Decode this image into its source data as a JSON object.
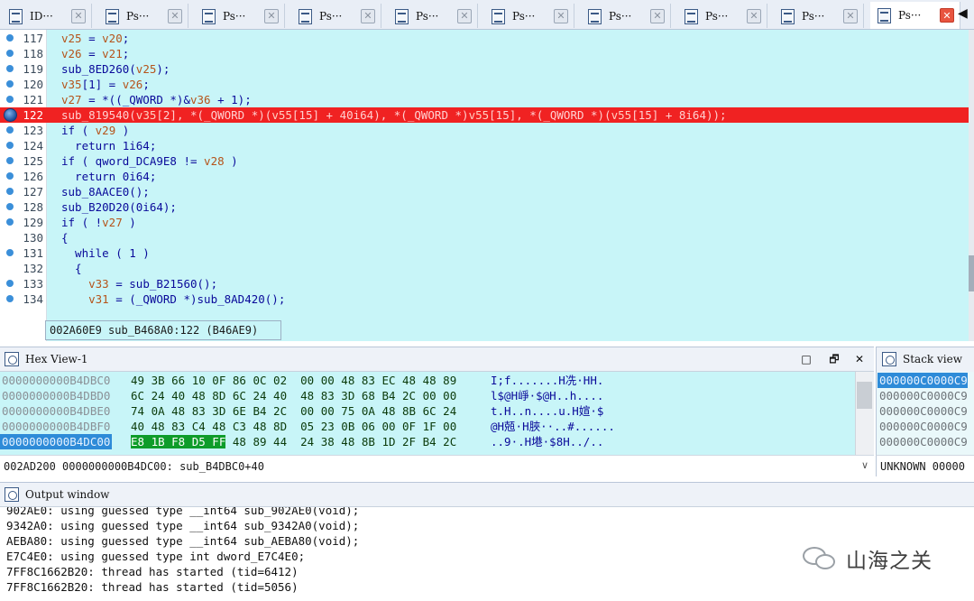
{
  "tabs": [
    {
      "label": "ID···",
      "active": false
    },
    {
      "label": "Ps···",
      "active": false
    },
    {
      "label": "Ps···",
      "active": false
    },
    {
      "label": "Ps···",
      "active": false
    },
    {
      "label": "Ps···",
      "active": false
    },
    {
      "label": "Ps···",
      "active": false
    },
    {
      "label": "Ps···",
      "active": false
    },
    {
      "label": "Ps···",
      "active": false
    },
    {
      "label": "Ps···",
      "active": false
    },
    {
      "label": "Ps···",
      "active": true
    }
  ],
  "tab_close_glyph": "✕",
  "tab_scroll_glyph": "◀",
  "code": {
    "lines": [
      {
        "num": "117",
        "text": "v25 = v20;"
      },
      {
        "num": "118",
        "text": "v26 = v21;"
      },
      {
        "num": "119",
        "text": "sub_8ED260(v25);"
      },
      {
        "num": "120",
        "text": "v35[1] = v26;"
      },
      {
        "num": "121",
        "text": "v27 = *((_QWORD *)&v36 + 1);"
      },
      {
        "num": "122",
        "text": "sub_819540(v35[2], *(_QWORD *)(v55[15] + 40i64), *(_QWORD *)v55[15], *(_QWORD *)(v55[15] + 8i64));",
        "breakpoint": true
      },
      {
        "num": "123",
        "text": "if ( v29 )"
      },
      {
        "num": "124",
        "text": "  return 1i64;"
      },
      {
        "num": "125",
        "text": "if ( qword_DCA9E8 != v28 )"
      },
      {
        "num": "126",
        "text": "  return 0i64;"
      },
      {
        "num": "127",
        "text": "sub_8AACE0();"
      },
      {
        "num": "128",
        "text": "sub_B20D20(0i64);"
      },
      {
        "num": "129",
        "text": "if ( !v27 )"
      },
      {
        "num": "130",
        "text": "{",
        "nodot": true
      },
      {
        "num": "131",
        "text": "  while ( 1 )"
      },
      {
        "num": "132",
        "text": "  {",
        "nodot": true
      },
      {
        "num": "133",
        "text": "    v33 = sub_B21560();"
      },
      {
        "num": "134",
        "text": "    v31 = (_QWORD *)sub_8AD420();"
      }
    ],
    "status": "002A60E9 sub_B468A0:122 (B46AE9)"
  },
  "hex_view": {
    "title": "Hex View-1",
    "minimize_glyph": "□",
    "restore_glyph": "🗗",
    "close_glyph": "✕",
    "rows": [
      {
        "addr": "0000000000B4DBC0",
        "bytes": "49 3B 66 10 0F 86 0C 02  00 00 48 83 EC 48 48 89",
        "ascii": "I;f.......H冼·HH."
      },
      {
        "addr": "0000000000B4DBD0",
        "bytes": "6C 24 40 48 8D 6C 24 40  48 83 3D 68 B4 2C 00 00",
        "ascii": "l$@H崢·$@H..h...."
      },
      {
        "addr": "0000000000B4DBE0",
        "bytes": "74 0A 48 83 3D 6E B4 2C  00 00 75 0A 48 8B 6C 24",
        "ascii": "t.H..n....u.H媗·$"
      },
      {
        "addr": "0000000000B4DBF0",
        "bytes": "40 48 83 C4 48 C3 48 8D  05 23 0B 06 00 0F 1F 00",
        "ascii": "@H兡·H脥··..#......"
      },
      {
        "addr": "0000000000B4DC00",
        "bytes_hl": "E8 1B F8 D5 FF",
        "bytes_rest": " 48 89 44  24 38 48 8B 1D 2F B4 2C",
        "ascii": "..9·.H塂·$8H../..",
        "selected": true
      }
    ],
    "status": "002AD200 0000000000B4DC00: sub_B4DBC0+40",
    "dropdown_glyph": "∨"
  },
  "stack_view": {
    "title": "Stack view",
    "rows": [
      "000000C0000C9",
      "000000C0000C9",
      "000000C0000C9",
      "000000C0000C9",
      "000000C0000C9"
    ],
    "status": "UNKNOWN 00000"
  },
  "output": {
    "title": "Output window",
    "lines": [
      "902AE0: using guessed type __int64 sub_902AE0(void);",
      "9342A0: using guessed type __int64 sub_9342A0(void);",
      "AEBA80: using guessed type __int64 sub_AEBA80(void);",
      "E7C4E0: using guessed type int dword_E7C4E0;",
      "7FF8C1662B20: thread has started (tid=6412)",
      "7FF8C1662B20: thread has started (tid=5056)"
    ]
  },
  "watermark": {
    "text": "山海之关"
  }
}
